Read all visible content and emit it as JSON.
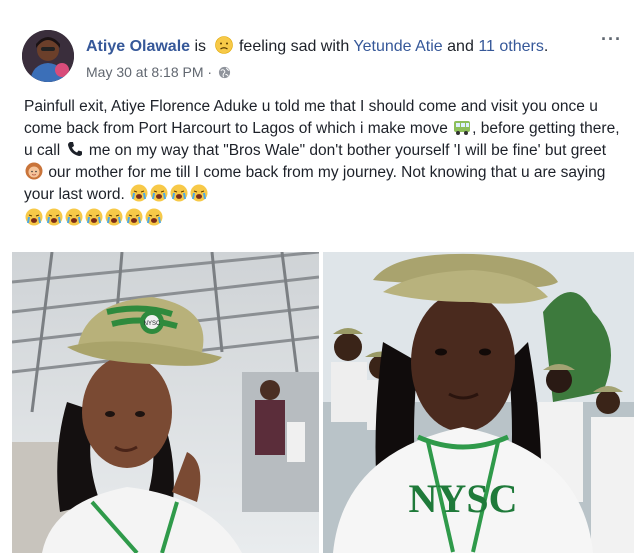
{
  "post": {
    "author": "Atiye Olawale",
    "is_word": "is",
    "feeling": "feeling sad with",
    "tagged_name": "Yetunde Atie",
    "and_word": "and",
    "others": "11 others",
    "period": ".",
    "timestamp": "May 30 at 8:18 PM",
    "separator": "·",
    "more_menu": "···",
    "icons": {
      "feeling": "sad-face-icon",
      "privacy": "globe-icon",
      "bus": "bus-icon",
      "phone": "phone-icon",
      "woman": "woman-icon",
      "crying": "crying-face-icon"
    },
    "body": {
      "part1": "Painfull exit, Atiye Florence Aduke u told me that I should come and visit you once u come back from Port Harcourt to Lagos of which i make move",
      "part2": ", before getting there, u call",
      "part3": "me on my way that \"Bros Wale\" don't bother yourself 'I will be fine' but greet",
      "part4": "our mother for me till I come back from my journey. Not knowing that u are saying your last word."
    },
    "photo_texts": {
      "left_cap_badge": "NYSC",
      "right_shirt_text": "NYSC"
    }
  }
}
